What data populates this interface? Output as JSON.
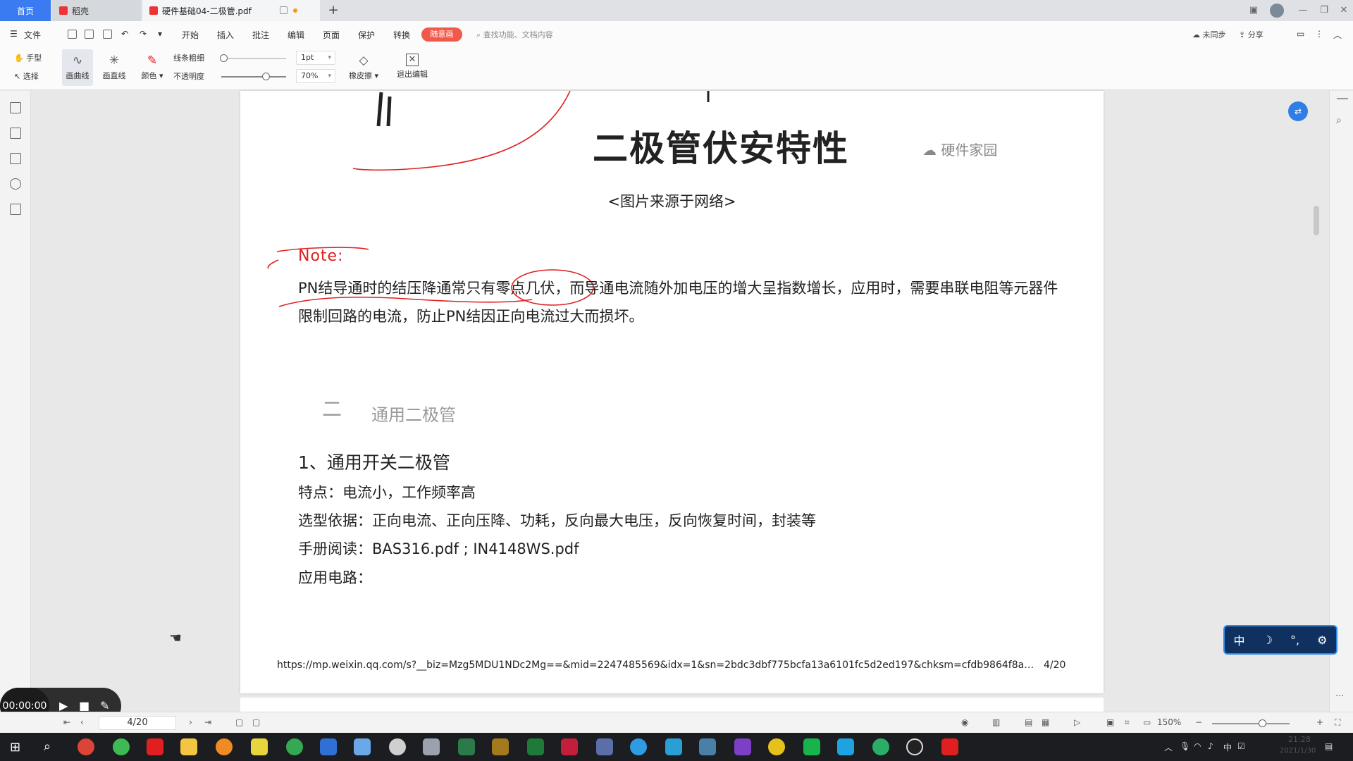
{
  "titlebar": {
    "tabs": [
      {
        "label": "首页"
      },
      {
        "label": "稻壳"
      },
      {
        "label": "硬件基础04-二极管.pdf"
      }
    ],
    "new_tab": "+"
  },
  "menubar": {
    "file_label": "文件",
    "items": [
      "开始",
      "插入",
      "批注",
      "编辑",
      "页面",
      "保护",
      "转换"
    ],
    "active_pill": "随意画",
    "search_placeholder": "查找功能、文档内容",
    "sync_label": "未同步",
    "share_label": "分享"
  },
  "toolbar": {
    "hand": "手型",
    "select": "选择",
    "curve": "画曲线",
    "line": "画直线",
    "color": "颜色",
    "thickness_label": "线条粗细",
    "opacity_label": "不透明度",
    "thickness_value": "1pt",
    "opacity_value": "70%",
    "eraser": "橡皮擦",
    "exit": "退出编辑",
    "accent_color": "#e02020"
  },
  "document": {
    "figure_title": "二极管伏安特性",
    "watermark": "硬件家园",
    "caption": "<图片来源于网络>",
    "note_label": "Note:",
    "note_body": "PN结导通时的结压降通常只有零点几伏，而导通电流随外加电压的增大呈指数增长，应用时，需要串联电阻等元器件限制回路的电流，防止PN结因正向电流过大而损坏。",
    "section_number": "二",
    "section_title": "通用二极管",
    "subsection": "1、通用开关二极管",
    "features": "特点：电流小，工作频率高",
    "selection_basis": "选型依据：正向电流、正向压降、功耗，反向最大电压，反向恢复时间，封装等",
    "manual": "手册阅读：BAS316.pdf ; IN4148WS.pdf",
    "circuit": "应用电路：",
    "url": "https://mp.weixin.qq.com/s?__biz=Mzg5MDU1NDc2Mg==&mid=2247485569&idx=1&sn=2bdc3dbf775bcfa13a6101fc5d2ed197&chksm=cfdb9864f8a…",
    "footer_page": "4/20"
  },
  "ime": {
    "lang": "中",
    "moon": "☽",
    "punct": "°,",
    "gear": "⚙"
  },
  "recorder": {
    "time": "00:00:00"
  },
  "statusbar": {
    "page_indicator": "4/20",
    "zoom": "150%"
  },
  "taskbar": {
    "tray_lang": "中",
    "time": "21:28",
    "date": "2021/1/30"
  },
  "colors": {
    "tab_active": "#3a7bf2",
    "pill": "#f15a4a",
    "note_red": "#e02020",
    "ime_bg": "#10315f"
  }
}
